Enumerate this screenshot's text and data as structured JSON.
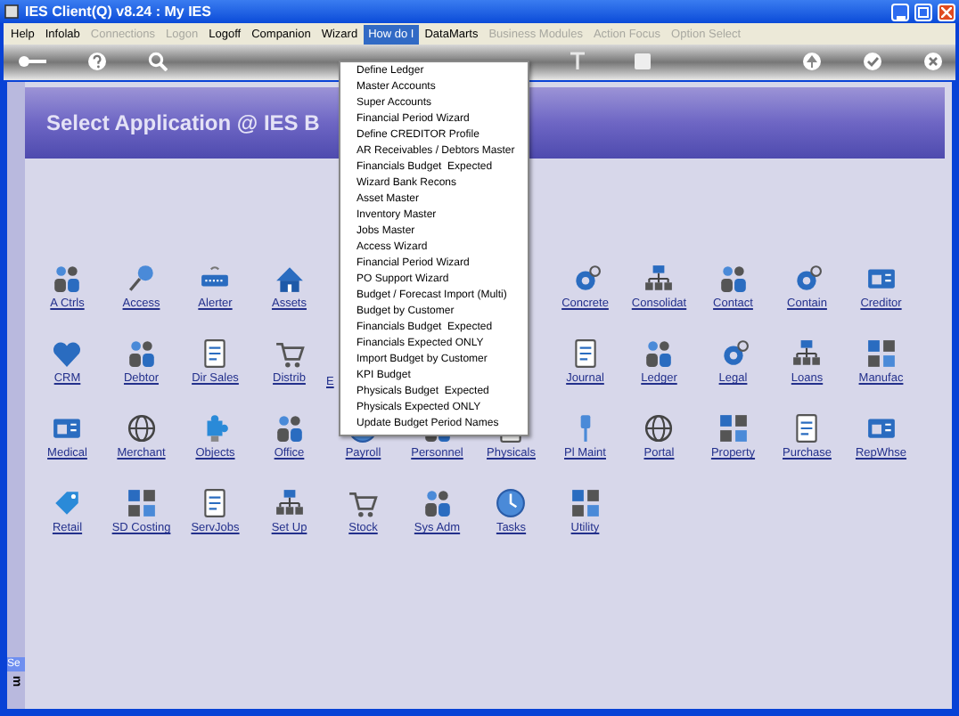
{
  "window": {
    "title": "IES Client(Q) v8.24 : My IES"
  },
  "menu_bar": [
    {
      "label": "Help",
      "disabled": false,
      "selected": false
    },
    {
      "label": "Infolab",
      "disabled": false,
      "selected": false
    },
    {
      "label": "Connections",
      "disabled": true,
      "selected": false
    },
    {
      "label": "Logon",
      "disabled": true,
      "selected": false
    },
    {
      "label": "Logoff",
      "disabled": false,
      "selected": false
    },
    {
      "label": "Companion",
      "disabled": false,
      "selected": false
    },
    {
      "label": "Wizard",
      "disabled": false,
      "selected": false
    },
    {
      "label": "How do I",
      "disabled": false,
      "selected": true
    },
    {
      "label": "DataMarts",
      "disabled": false,
      "selected": false
    },
    {
      "label": "Business Modules",
      "disabled": true,
      "selected": false
    },
    {
      "label": "Action Focus",
      "disabled": true,
      "selected": false
    },
    {
      "label": "Option Select",
      "disabled": true,
      "selected": false
    }
  ],
  "banner": {
    "title": "Select Application @ IES B"
  },
  "dropdown": [
    "Define Ledger",
    "Master Accounts",
    "Super Accounts",
    "Financial Period Wizard",
    "Define CREDITOR Profile",
    "AR Receivables / Debtors Master",
    "Financials Budget  Expected",
    "Wizard Bank Recons",
    "Asset Master",
    "Inventory Master",
    "Jobs Master",
    "Access Wizard",
    "Financial Period Wizard",
    "PO Support Wizard",
    "Budget / Forecast Import (Multi)",
    "Budget by Customer",
    "Financials Budget  Expected",
    "Financials Expected ONLY",
    "Import Budget by Customer",
    "KPI Budget",
    "Physicals Budget  Expected",
    "Physicals Expected ONLY",
    "Update Budget Period Names"
  ],
  "app_rows": [
    {
      "left": [
        {
          "label": "A Ctrls",
          "kind": "app"
        },
        {
          "label": "Access",
          "kind": "app"
        },
        {
          "label": "Alerter",
          "kind": "app"
        },
        {
          "label": "Assets",
          "kind": "app"
        }
      ],
      "right": [
        {
          "label": "Concrete",
          "kind": "app"
        },
        {
          "label": "Consolidat",
          "kind": "app"
        },
        {
          "label": "Contact",
          "kind": "app"
        },
        {
          "label": "Contain",
          "kind": "app"
        },
        {
          "label": "Creditor",
          "kind": "app"
        }
      ]
    },
    {
      "left": [
        {
          "label": "CRM",
          "kind": "app"
        },
        {
          "label": "Debtor",
          "kind": "app"
        },
        {
          "label": "Dir Sales",
          "kind": "app"
        },
        {
          "label": "Distrib",
          "kind": "app"
        },
        {
          "label": "E",
          "kind": "partial"
        }
      ],
      "right": [
        {
          "label": "Journal",
          "kind": "app"
        },
        {
          "label": "Ledger",
          "kind": "app"
        },
        {
          "label": "Legal",
          "kind": "app"
        },
        {
          "label": "Loans",
          "kind": "app"
        },
        {
          "label": "Manufac",
          "kind": "app"
        }
      ]
    },
    {
      "left": [
        {
          "label": "Medical",
          "kind": "app"
        },
        {
          "label": "Merchant",
          "kind": "app"
        },
        {
          "label": "Objects",
          "kind": "app"
        },
        {
          "label": "Office",
          "kind": "app"
        },
        {
          "label": "Payroll",
          "kind": "app"
        },
        {
          "label": "Personnel",
          "kind": "app"
        },
        {
          "label": "Physicals",
          "kind": "app"
        },
        {
          "label": "Pl Maint",
          "kind": "app"
        },
        {
          "label": "Portal",
          "kind": "app"
        },
        {
          "label": "Property",
          "kind": "app"
        },
        {
          "label": "Purchase",
          "kind": "app"
        },
        {
          "label": "RepWhse",
          "kind": "app"
        }
      ]
    },
    {
      "left": [
        {
          "label": "Retail",
          "kind": "app"
        },
        {
          "label": "SD Costing",
          "kind": "app"
        },
        {
          "label": "ServJobs",
          "kind": "app"
        },
        {
          "label": "Set Up",
          "kind": "app"
        },
        {
          "label": "Stock",
          "kind": "app"
        },
        {
          "label": "Sys Adm",
          "kind": "app"
        },
        {
          "label": "Tasks",
          "kind": "app"
        },
        {
          "label": "Utility",
          "kind": "app"
        }
      ]
    }
  ],
  "side_panel": {
    "tab": "Se",
    "text": "m"
  }
}
